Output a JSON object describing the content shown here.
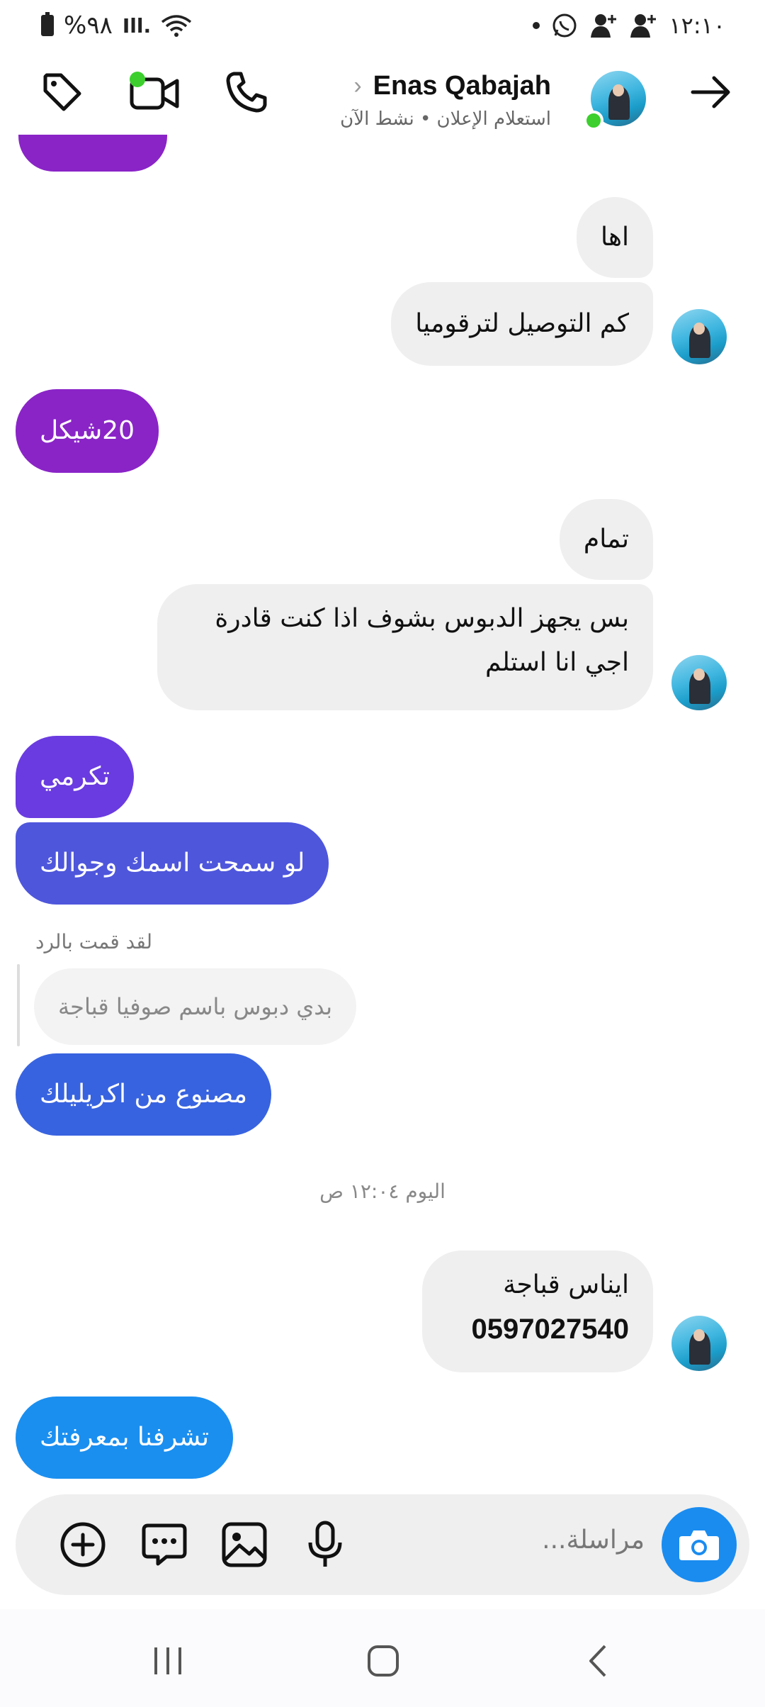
{
  "status_bar": {
    "battery_text": "%٩٨",
    "signal_text": "Ill.",
    "time": "١٢:١٠"
  },
  "header": {
    "name": "Enas Qabajah",
    "subtitle": "استعلام الإعلان • نشط الآن"
  },
  "messages": {
    "m1": "اها",
    "m2": "كم التوصيل لترقوميا",
    "m3": "20شيكل",
    "m4": "تمام",
    "m5_line1": "بس يجهز الدبوس بشوف اذا كنت قادرة",
    "m5_line2": "اجي انا استلم",
    "m6": "تكرمي",
    "m7": "لو سمحت اسمك وجوالك",
    "reply_label": "لقد قمت بالرد",
    "reply_quote": "بدي دبوس باسم صوفيا قباجة",
    "m8": "مصنوع من اكريليلك",
    "day_separator": "اليوم ١٢:٠٤ ص",
    "m9_line1": "ايناس قباجة",
    "m9_line2": "0597027540",
    "m10": "تشرفنا بمعرفتك"
  },
  "composer": {
    "placeholder": "مراسلة..."
  },
  "colors": {
    "purple": "#8a24c7",
    "violet": "#6a3be0",
    "indigo": "#4e56dc",
    "blue": "#3863e0",
    "sky": "#1a8ff0",
    "online": "#3ccf2e"
  }
}
